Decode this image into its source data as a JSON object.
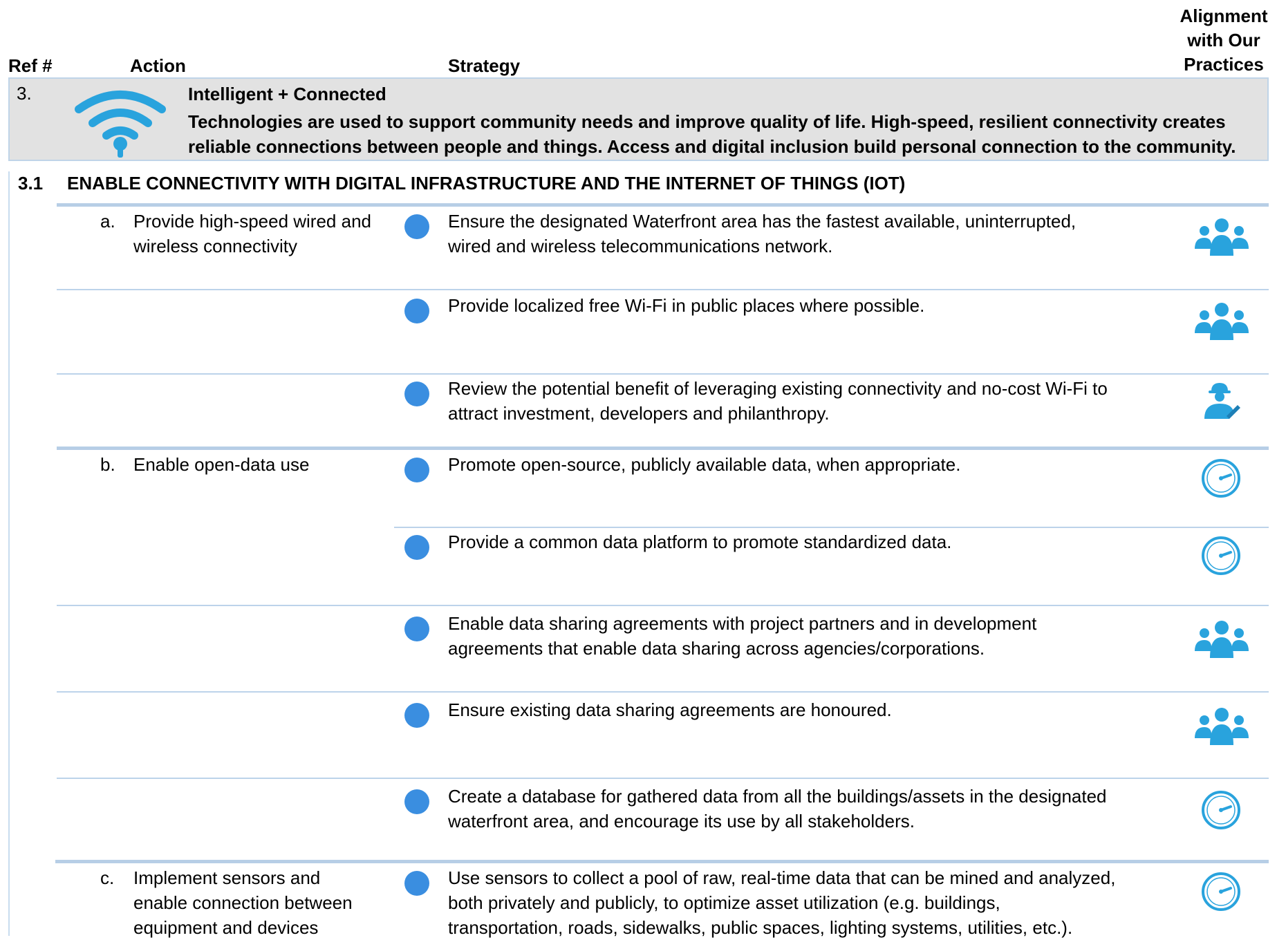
{
  "headers": {
    "ref": "Ref #",
    "action": "Action",
    "strategy": "Strategy",
    "alignment_line1": "Alignment",
    "alignment_line2": "with Our",
    "alignment_line3": "Practices"
  },
  "banner": {
    "ref": "3.",
    "icon": "wifi-icon",
    "title": "Intelligent + Connected",
    "desc_line1": "Technologies are used to support community needs and improve quality of life. High-speed, resilient connectivity creates",
    "desc_line2": "reliable connections between people and things. Access and digital inclusion build personal connection to the community."
  },
  "section": {
    "num": "3.1",
    "title": "ENABLE CONNECTIVITY WITH DIGITAL INFRASTRUCTURE AND THE INTERNET OF THINGS (IOT)"
  },
  "actions": [
    {
      "letter": "a.",
      "line1": "Provide high-speed wired and",
      "line2": "wireless connectivity",
      "line3": ""
    },
    {
      "letter": "b.",
      "line1": "Enable open-data use",
      "line2": "",
      "line3": ""
    },
    {
      "letter": "c.",
      "line1": "Implement sensors and",
      "line2": "enable connection between",
      "line3": "equipment and devices"
    }
  ],
  "strategies": [
    {
      "line1": "Ensure the designated Waterfront area has the fastest available, uninterrupted,",
      "line2": "wired and wireless telecommunications network.",
      "line3": "",
      "icon": "people-group-icon"
    },
    {
      "line1": "Provide localized free Wi-Fi in public places where possible.",
      "line2": "",
      "line3": "",
      "icon": "people-group-icon"
    },
    {
      "line1": "Review the potential benefit of leveraging existing connectivity and no-cost Wi-Fi to",
      "line2": "attract investment, developers and philanthropy.",
      "line3": "",
      "icon": "worker-icon"
    },
    {
      "line1": "Promote open-source, publicly available data, when appropriate.",
      "line2": "",
      "line3": "",
      "icon": "gauge-icon"
    },
    {
      "line1": "Provide a common data platform to promote standardized data.",
      "line2": "",
      "line3": "",
      "icon": "gauge-icon"
    },
    {
      "line1": "Enable data sharing agreements with project partners and in development",
      "line2": "agreements that enable data sharing across agencies/corporations.",
      "line3": "",
      "icon": "people-group-icon"
    },
    {
      "line1": "Ensure existing data sharing agreements are honoured.",
      "line2": "",
      "line3": "",
      "icon": "people-group-icon"
    },
    {
      "line1": "Create a database for gathered data from all the buildings/assets in the designated",
      "line2": "waterfront area, and encourage its use by all stakeholders.",
      "line3": "",
      "icon": "gauge-icon"
    },
    {
      "line1": "Use sensors to collect a pool of raw, real-time data that can be mined and analyzed,",
      "line2": "both privately and publicly, to optimize asset utilization (e.g. buildings,",
      "line3": "transportation, roads, sidewalks, public spaces, lighting systems, utilities, etc.).",
      "icon": "gauge-icon"
    }
  ],
  "colors": {
    "accent": "#3a8ee0",
    "icon_blue": "#29a3dd",
    "banner_bg": "#e2e2e2",
    "rule": "#bcd3ea"
  }
}
